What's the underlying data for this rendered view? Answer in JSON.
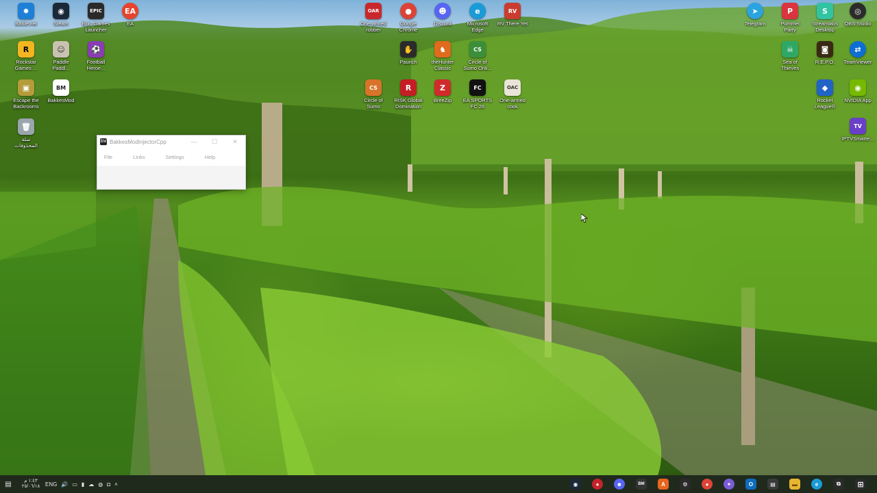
{
  "desktop_icons": [
    {
      "label": "Battle.net",
      "icon": "battlenet-icon",
      "color": "#1d7fd6",
      "glyph": "✹"
    },
    {
      "label": "Steam",
      "icon": "steam-icon",
      "color": "#1b2838",
      "glyph": "◉"
    },
    {
      "label": "Epic Games\nLauncher",
      "icon": "epic-games-icon",
      "color": "#2a2a2a",
      "glyph": "EPIC"
    },
    {
      "label": "EA",
      "icon": "ea-icon",
      "color": "#e8442d",
      "glyph": "EA"
    },
    {
      "label": "Rockstar\nGames ...",
      "icon": "rockstar-icon",
      "color": "#f3b520",
      "glyph": "R"
    },
    {
      "label": "Paddle\nPaddl...",
      "icon": "paddle-paddle-icon",
      "color": "#c9c2b0",
      "glyph": "☺"
    },
    {
      "label": "Football\nHeroe...",
      "icon": "football-heroes-icon",
      "color": "#8a3db3",
      "glyph": "⚽"
    },
    {
      "label": "Escape the\nBackrooms",
      "icon": "escape-backrooms-icon",
      "color": "#b59c3a",
      "glyph": "▣"
    },
    {
      "label": "BakkesMod",
      "icon": "bakkesmod-icon",
      "color": "#ffffff",
      "glyph": "BM"
    },
    {
      "label": "سلة\nالمحذوفات",
      "icon": "recycle-bin-icon",
      "color": "#9aa5ad",
      "glyph": "🗑"
    },
    {
      "label": "One-armed\nrobber",
      "icon": "one-armed-robber-icon",
      "color": "#c8282c",
      "glyph": "OAR"
    },
    {
      "label": "Google\nChrome",
      "icon": "chrome-icon",
      "color": "#db4437",
      "glyph": "●"
    },
    {
      "label": "Discord",
      "icon": "discord-icon",
      "color": "#5865f2",
      "glyph": "☻"
    },
    {
      "label": "Microsoft\nEdge",
      "icon": "edge-icon",
      "color": "#1a9bd7",
      "glyph": "e"
    },
    {
      "label": "RV There Yet",
      "icon": "rv-there-yet-icon",
      "color": "#c93c2f",
      "glyph": "RV"
    },
    {
      "label": "Paunch",
      "icon": "paunch-icon",
      "color": "#2b2b2b",
      "glyph": "✋"
    },
    {
      "label": "theHunter\nClassic",
      "icon": "thehunter-icon",
      "color": "#e06a1e",
      "glyph": "♞"
    },
    {
      "label": "Circle of\nSumo Onli...",
      "icon": "circle-of-sumo-online-icon",
      "color": "#3c8f3a",
      "glyph": "CS"
    },
    {
      "label": "Circle of\nSumo",
      "icon": "circle-of-sumo-icon",
      "color": "#d8742a",
      "glyph": "CS"
    },
    {
      "label": "RISK Global\nDomination",
      "icon": "risk-icon",
      "color": "#c41e24",
      "glyph": "R"
    },
    {
      "label": "BreeZip",
      "icon": "breezip-icon",
      "color": "#d02b2b",
      "glyph": "Z"
    },
    {
      "label": "EA SPORTS\nFC 26",
      "icon": "ea-sports-fc-icon",
      "color": "#111111",
      "glyph": "FC"
    },
    {
      "label": "One-armed\ncook",
      "icon": "one-armed-cook-icon",
      "color": "#e9e4d8",
      "glyph": "OAC"
    },
    {
      "label": "Telegram",
      "icon": "telegram-icon",
      "color": "#2aa3e0",
      "glyph": "➤"
    },
    {
      "label": "Pummel\nParty",
      "icon": "pummel-party-icon",
      "color": "#d9343f",
      "glyph": "P"
    },
    {
      "label": "Streamlabs\nDesktop",
      "icon": "streamlabs-icon",
      "color": "#31c3a2",
      "glyph": "S"
    },
    {
      "label": "OBS Studio",
      "icon": "obs-icon",
      "color": "#2b2b2b",
      "glyph": "◎"
    },
    {
      "label": "Sea of\nThieves",
      "icon": "sea-of-thieves-icon",
      "color": "#2fa866",
      "glyph": "☠"
    },
    {
      "label": "R.E.P.O.",
      "icon": "repo-icon",
      "color": "#3a2a14",
      "glyph": "◙"
    },
    {
      "label": "TeamViewer",
      "icon": "teamviewer-icon",
      "color": "#0e6ed3",
      "glyph": "⇄"
    },
    {
      "label": "Rocket\nLeague®",
      "icon": "rocket-league-icon",
      "color": "#2163c7",
      "glyph": "◆"
    },
    {
      "label": "NVIDIA App",
      "icon": "nvidia-icon",
      "color": "#76b900",
      "glyph": "◉"
    },
    {
      "label": "IPTVSmarte...",
      "icon": "iptv-smarters-icon",
      "color": "#6a3fc8",
      "glyph": "TV"
    }
  ],
  "window": {
    "title": "BakkesModInjectorCpp",
    "app_glyph": "BM",
    "menu": [
      "File",
      "Links",
      "Settings",
      "Help"
    ]
  },
  "taskbar": {
    "clock_time": "١:٤٣ م",
    "clock_date": "٢٥/٠٦/١٨",
    "language": "ENG",
    "pinned": [
      {
        "icon": "steam-icon",
        "color": "#1b2838",
        "glyph": "◉"
      },
      {
        "icon": "app-red-icon",
        "color": "#c4242a",
        "glyph": "●"
      },
      {
        "icon": "discord-icon",
        "color": "#5865f2",
        "glyph": "☻"
      },
      {
        "icon": "bakkesmod-icon",
        "color": "#333333",
        "glyph": "BM"
      },
      {
        "icon": "orange-app-icon",
        "color": "#e8651f",
        "glyph": "A"
      },
      {
        "icon": "gear-app-icon",
        "color": "#2b2b2b",
        "glyph": "⚙"
      },
      {
        "icon": "chrome-icon",
        "color": "#db4437",
        "glyph": "●"
      },
      {
        "icon": "copilot-icon",
        "color": "#7b5cd6",
        "glyph": "✦"
      },
      {
        "icon": "outlook-icon",
        "color": "#0f6cbd",
        "glyph": "O"
      },
      {
        "icon": "store-icon",
        "color": "#3a3a3a",
        "glyph": "▤"
      },
      {
        "icon": "file-explorer-icon",
        "color": "#e8b530",
        "glyph": "▬"
      },
      {
        "icon": "edge-icon",
        "color": "#1a9bd7",
        "glyph": "e"
      },
      {
        "icon": "task-view-icon",
        "color": "#2b2b2b",
        "glyph": "⧉"
      },
      {
        "icon": "windows-start-icon",
        "color": "#2b2b2b",
        "glyph": "⊞"
      }
    ]
  }
}
